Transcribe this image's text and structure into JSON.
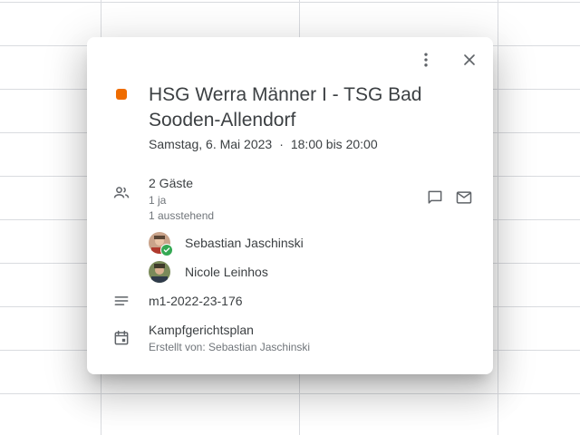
{
  "event": {
    "title": "HSG Werra Männer I - TSG Bad Sooden-Allendorf",
    "date": "Samstag, 6. Mai 2023",
    "separator": "·",
    "time": "18:00 bis 20:00",
    "color": "#ef6c00"
  },
  "guests": {
    "summary": "2 Gäste",
    "yes_count": "1 ja",
    "pending_count": "1 ausstehend",
    "list": [
      {
        "name": "Sebastian Jaschinski",
        "status": "accepted"
      },
      {
        "name": "Nicole Leinhos",
        "status": "pending"
      }
    ]
  },
  "description": "m1-2022-23-176",
  "calendar": {
    "name": "Kampfgerichtsplan",
    "creator": "Erstellt von: Sebastian Jaschinski"
  },
  "icons": {
    "more": "more-vert-icon",
    "close": "close-icon",
    "guests": "people-icon",
    "chat": "chat-icon",
    "mail": "mail-icon",
    "description": "notes-icon",
    "calendar": "calendar-icon"
  }
}
